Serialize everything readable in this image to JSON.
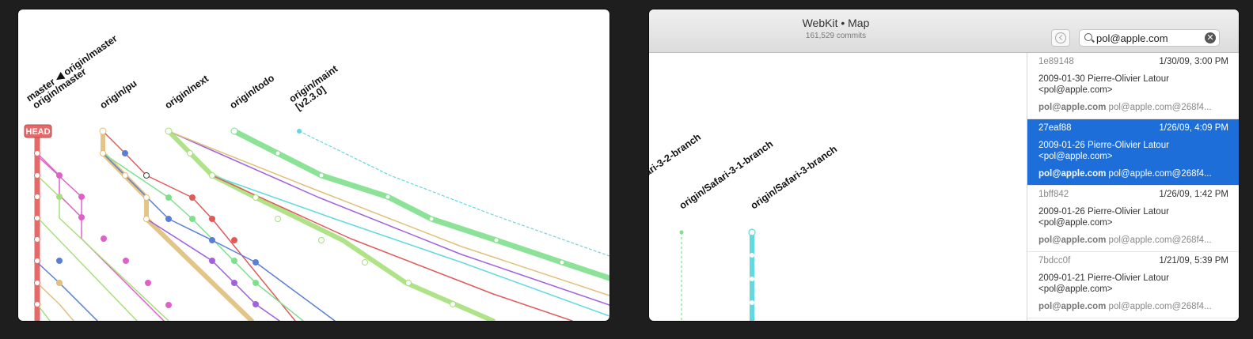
{
  "left_window": {
    "refs": [
      "master ◀ origin/master",
      "origin/master",
      "origin/pu",
      "origin/next",
      "origin/todo",
      "origin/maint",
      "[v2.3.0]"
    ],
    "head_badge": "HEAD",
    "colors": {
      "head": "#e46a6a",
      "pu": "#e0c07a",
      "next": "#a6e07a",
      "todo": "#7fe08c",
      "maint": "#62d8e0",
      "pink": "#e060c8",
      "blue": "#5a7ed8",
      "purple": "#a060e0",
      "red": "#e05a5a"
    }
  },
  "right_window": {
    "title": "WebKit • Map",
    "subtitle": "161,529 commits",
    "search_value": "pol@apple.com",
    "branch_labels": [
      "ari-3-2-branch",
      "origin/Safari-3-1-branch",
      "origin/Safari-3-branch"
    ],
    "results": [
      {
        "hash": "1e89148",
        "date": "1/30/09, 3:00 PM",
        "line2": "2009-01-30  Pierre-Olivier Latour",
        "line3": "<pol@apple.com>",
        "email_bold": "pol@apple.com",
        "email_rest": "pol@apple.com@268f4...",
        "selected": false
      },
      {
        "hash": "27eaf88",
        "date": "1/26/09, 4:09 PM",
        "line2": "2009-01-26  Pierre-Olivier Latour",
        "line3": "<pol@apple.com>",
        "email_bold": "pol@apple.com",
        "email_rest": "pol@apple.com@268f4...",
        "selected": true
      },
      {
        "hash": "1bff842",
        "date": "1/26/09, 1:42 PM",
        "line2": "2009-01-26  Pierre-Olivier Latour",
        "line3": "<pol@apple.com>",
        "email_bold": "pol@apple.com",
        "email_rest": "pol@apple.com@268f4...",
        "selected": false
      },
      {
        "hash": "7bdcc0f",
        "date": "1/21/09, 5:39 PM",
        "line2": "2009-01-21  Pierre-Olivier Latour",
        "line3": "<pol@apple.com>",
        "email_bold": "pol@apple.com",
        "email_rest": "pol@apple.com@268f4...",
        "selected": false
      }
    ]
  }
}
